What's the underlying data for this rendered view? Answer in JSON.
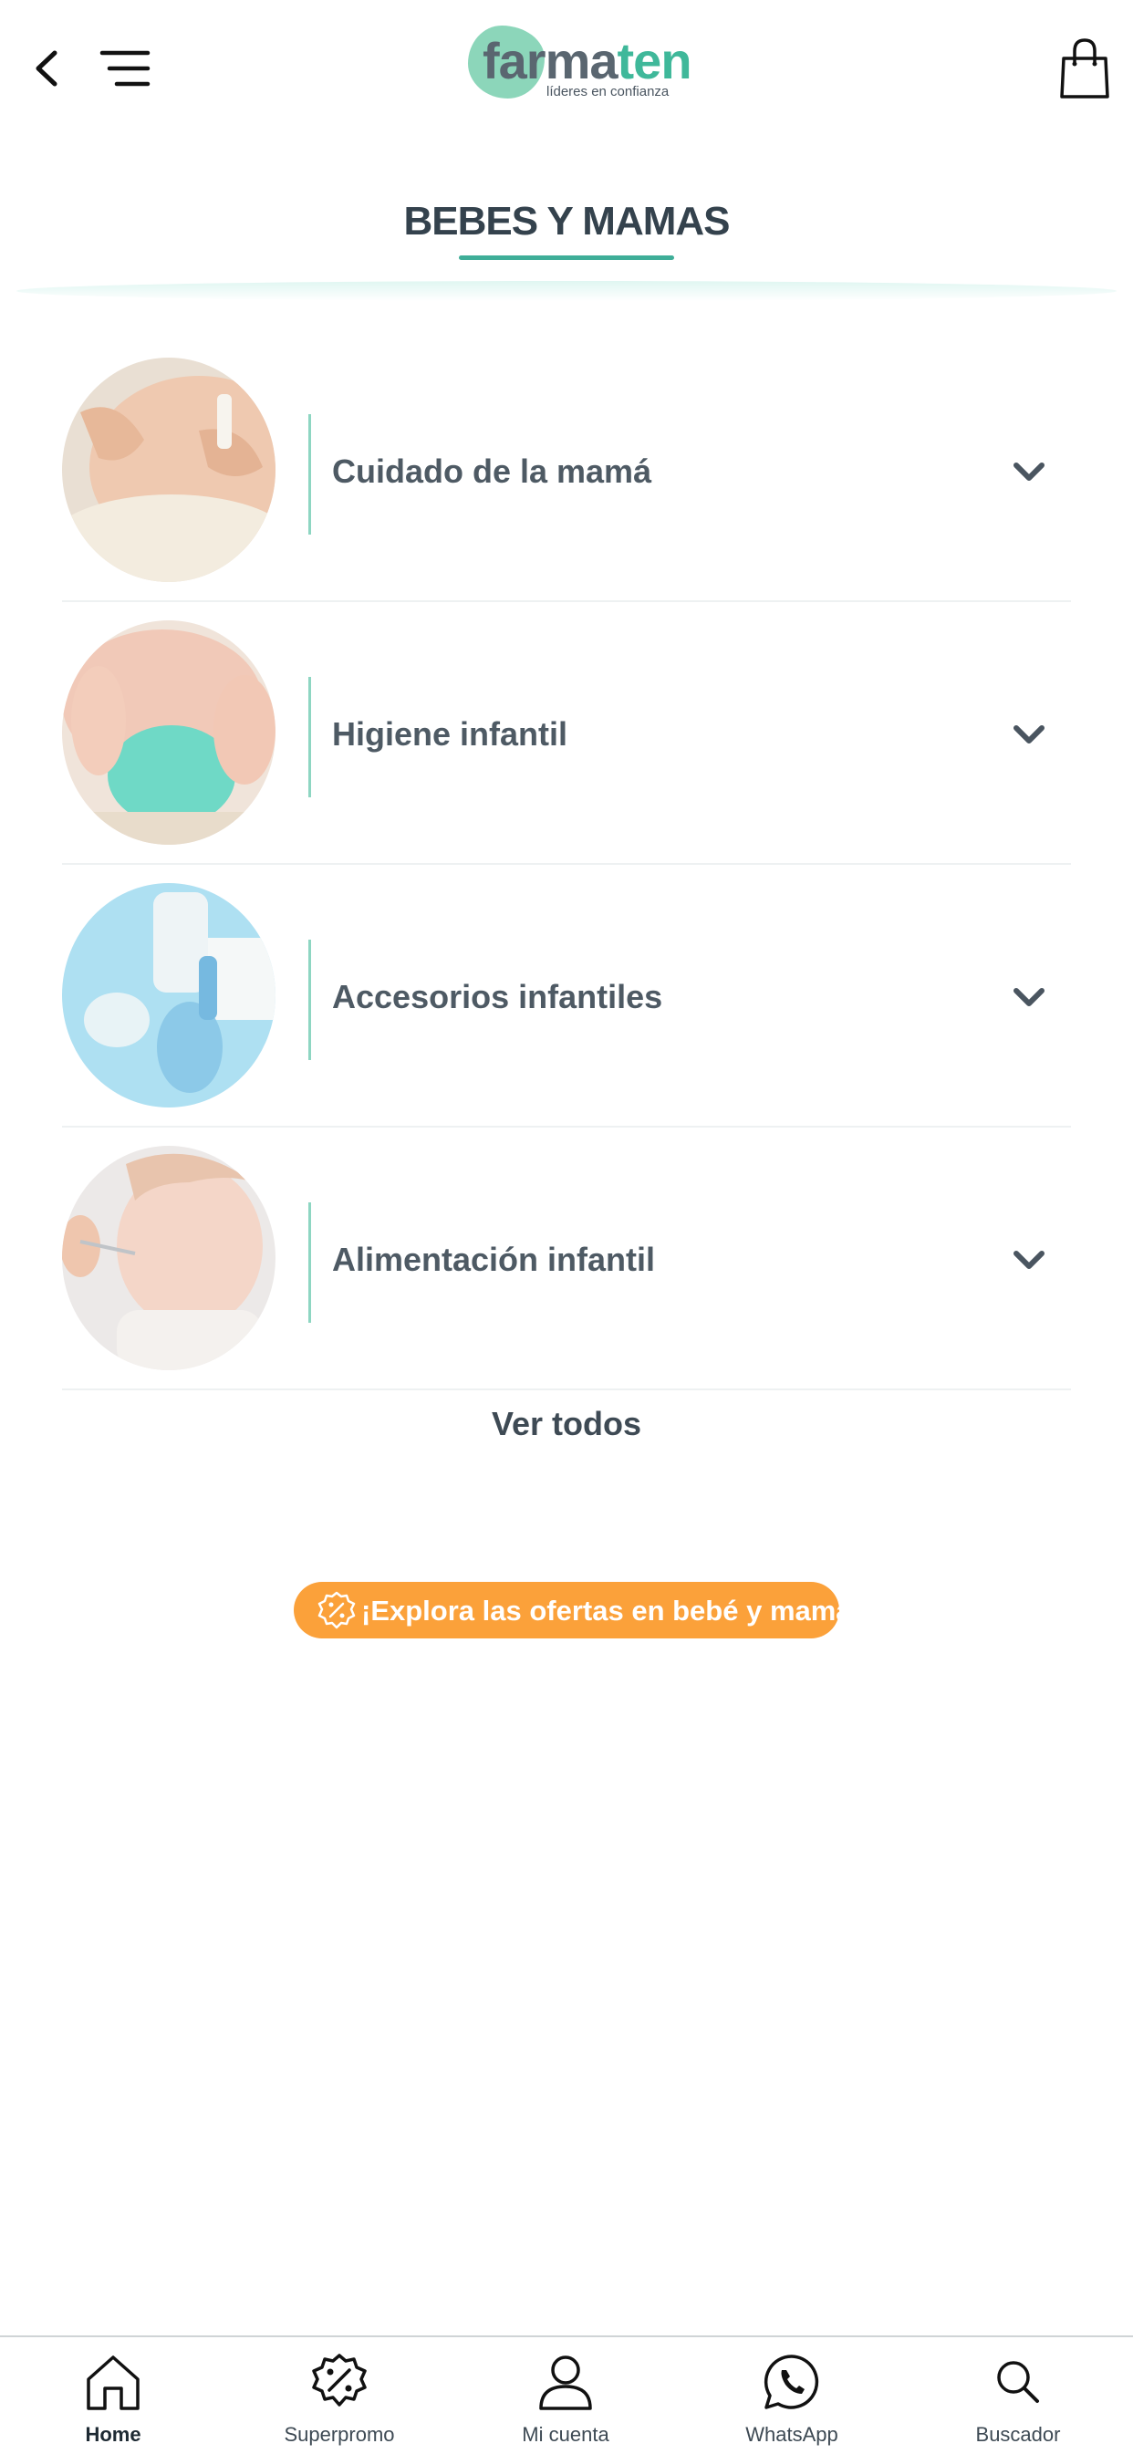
{
  "header": {
    "logo_primary": "farma",
    "logo_accent": "ten",
    "logo_tagline": "líderes en confianza"
  },
  "page": {
    "title": "BEBES Y MAMAS"
  },
  "categories": [
    {
      "label": "Cuidado de la mamá"
    },
    {
      "label": "Higiene infantil"
    },
    {
      "label": "Accesorios infantiles"
    },
    {
      "label": "Alimentación infantil"
    }
  ],
  "see_all": "Ver todos",
  "promo": {
    "text": "¡Explora las ofertas en bebé y mamá",
    "color": "#fba13a"
  },
  "bottom_nav": [
    {
      "label": "Home",
      "icon": "home-icon",
      "active": true
    },
    {
      "label": "Superpromo",
      "icon": "percent-badge-icon"
    },
    {
      "label": "Mi cuenta",
      "icon": "user-icon"
    },
    {
      "label": "WhatsApp",
      "icon": "whatsapp-icon"
    },
    {
      "label": "Buscador",
      "icon": "search-icon"
    }
  ],
  "colors": {
    "accent": "#3fae98",
    "promo": "#fba13a",
    "text": "#3d4a54"
  }
}
